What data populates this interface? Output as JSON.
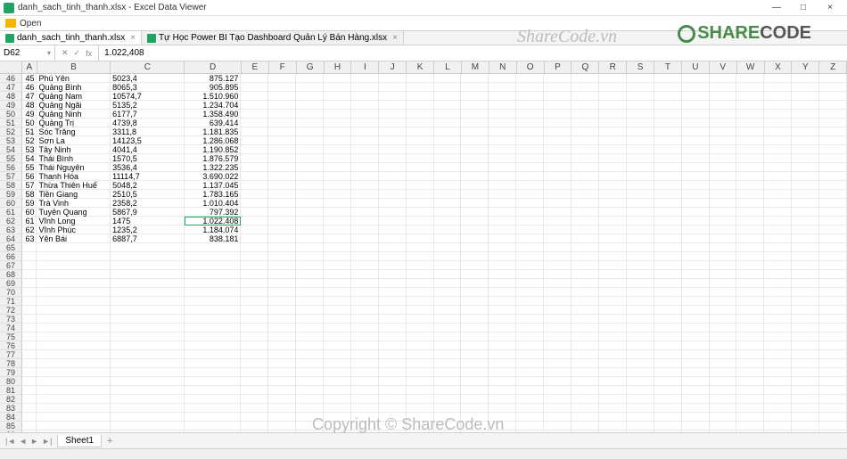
{
  "window": {
    "title": "danh_sach_tinh_thanh.xlsx - Excel Data Viewer",
    "min": "—",
    "max": "□",
    "close": "×"
  },
  "toolbar": {
    "open": "Open"
  },
  "tabs": {
    "active": "danh_sach_tinh_thanh.xlsx",
    "inactive": "Tự Học Power BI Tạo Dashboard Quản Lý Bán Hàng.xlsx",
    "close": "×"
  },
  "formulaBar": {
    "cellRef": "D62",
    "cancel": "✕",
    "enter": "✓",
    "fx": "fx",
    "value": "1.022,408"
  },
  "columns": [
    "A",
    "B",
    "C",
    "D",
    "E",
    "F",
    "G",
    "H",
    "I",
    "J",
    "K",
    "L",
    "M",
    "N",
    "O",
    "P",
    "Q",
    "R",
    "S",
    "T",
    "U",
    "V",
    "W",
    "X",
    "Y",
    "Z"
  ],
  "columnWidths": {
    "A": "cA",
    "B": "cB",
    "C": "cC",
    "D": "cD"
  },
  "startRow": 46,
  "endRow": 87,
  "selectedCell": {
    "row": 62,
    "col": "D"
  },
  "data": [
    {
      "r": 46,
      "A": "45",
      "B": "Phú Yên",
      "C": "5023,4",
      "D": "875.127"
    },
    {
      "r": 47,
      "A": "46",
      "B": "Quảng Bình",
      "C": "8065,3",
      "D": "905.895"
    },
    {
      "r": 48,
      "A": "47",
      "B": "Quảng Nam",
      "C": "10574,7",
      "D": "1.510.960"
    },
    {
      "r": 49,
      "A": "48",
      "B": "Quảng Ngãi",
      "C": "5135,2",
      "D": "1.234.704"
    },
    {
      "r": 50,
      "A": "49",
      "B": "Quảng Ninh",
      "C": "6177,7",
      "D": "1.358.490"
    },
    {
      "r": 51,
      "A": "50",
      "B": "Quảng Trị",
      "C": "4739,8",
      "D": "639.414"
    },
    {
      "r": 52,
      "A": "51",
      "B": "Sóc Trăng",
      "C": "3311,8",
      "D": "1.181.835"
    },
    {
      "r": 53,
      "A": "52",
      "B": "Sơn La",
      "C": "14123,5",
      "D": "1.286.068"
    },
    {
      "r": 54,
      "A": "53",
      "B": "Tây Ninh",
      "C": "4041,4",
      "D": "1.190.852"
    },
    {
      "r": 55,
      "A": "54",
      "B": "Thái Bình",
      "C": "1570,5",
      "D": "1.876.579"
    },
    {
      "r": 56,
      "A": "55",
      "B": "Thái Nguyên",
      "C": "3536,4",
      "D": "1.322.235"
    },
    {
      "r": 57,
      "A": "56",
      "B": "Thanh Hóa",
      "C": "11114,7",
      "D": "3.690.022"
    },
    {
      "r": 58,
      "A": "57",
      "B": "Thừa Thiên Huế",
      "C": "5048,2",
      "D": "1.137.045"
    },
    {
      "r": 59,
      "A": "58",
      "B": "Tiền Giang",
      "C": "2510,5",
      "D": "1.783.165"
    },
    {
      "r": 60,
      "A": "59",
      "B": "Trà Vinh",
      "C": "2358,2",
      "D": "1.010.404"
    },
    {
      "r": 61,
      "A": "60",
      "B": "Tuyên Quang",
      "C": "5867,9",
      "D": "797.392"
    },
    {
      "r": 62,
      "A": "61",
      "B": "Vĩnh Long",
      "C": "1475",
      "D": "1.022.408"
    },
    {
      "r": 63,
      "A": "62",
      "B": "Vĩnh Phúc",
      "C": "1235,2",
      "D": "1.184.074"
    },
    {
      "r": 64,
      "A": "63",
      "B": "Yên Bái",
      "C": "6887,7",
      "D": "838.181"
    }
  ],
  "sheetBar": {
    "navFirst": "|◄",
    "navPrev": "◄",
    "navNext": "►",
    "navLast": "►|",
    "sheet": "Sheet1",
    "add": "+"
  },
  "watermarks": {
    "brand_share": "SHARE",
    "brand_code": "CODE",
    "wm_small": "ShareCode.vn",
    "copyright": "Copyright © ShareCode.vn"
  }
}
